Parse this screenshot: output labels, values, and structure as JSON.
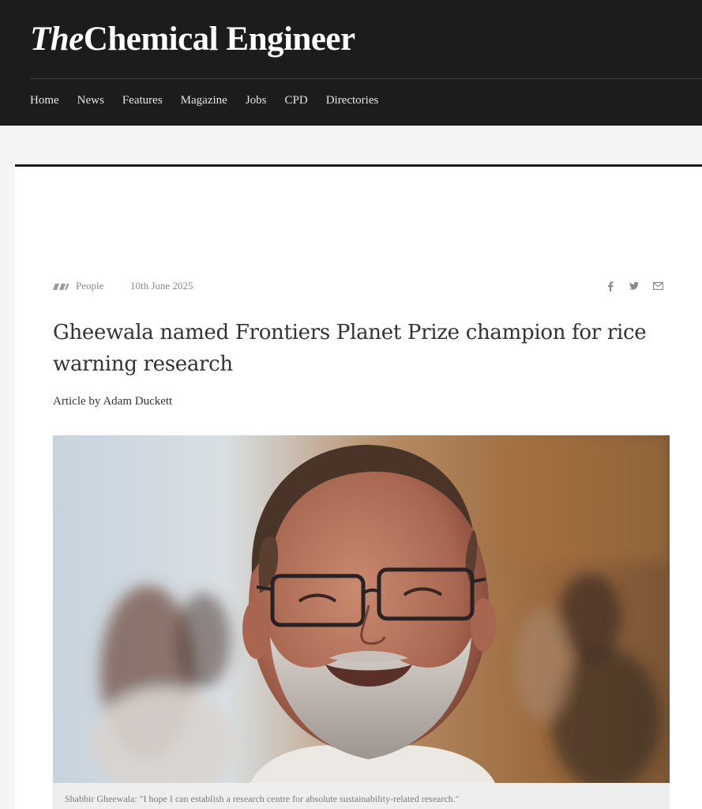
{
  "site": {
    "logo_the": "The",
    "logo_main": "Chemical Engineer"
  },
  "nav": {
    "items": [
      "Home",
      "News",
      "Features",
      "Magazine",
      "Jobs",
      "CPD",
      "Directories"
    ]
  },
  "article": {
    "category": "People",
    "category_icon": "category-slash-icon",
    "date": "10th June 2025",
    "share_icons": [
      "facebook-icon",
      "twitter-icon",
      "email-icon"
    ],
    "title": "Gheewala named Frontiers Planet Prize champion for rice warning research",
    "byline_prefix": "Article by ",
    "author": "Adam Duckett",
    "image_caption": "Shabbir Gheewala: \"I hope I can establish a research centre for absolute sustainability-related research.\""
  },
  "colors": {
    "header_bg": "#1c1c1d",
    "page_bg": "#f4f4f4",
    "text": "#333333",
    "muted": "#8a8a8a"
  }
}
